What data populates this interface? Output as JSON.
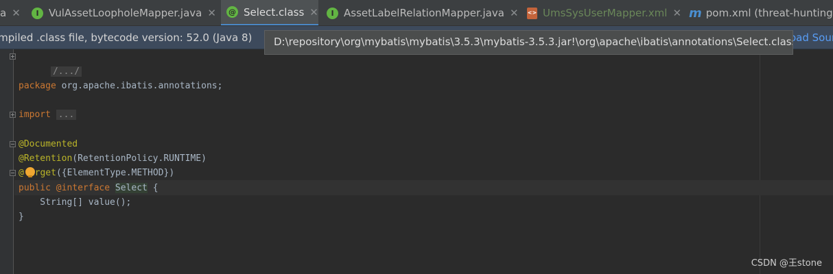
{
  "tabs": [
    {
      "label": "a",
      "icon": "class-file-icon",
      "active": false
    },
    {
      "label": "VulAssetLoopholeMapper.java",
      "icon": "interface-icon",
      "active": false
    },
    {
      "label": "Select.class",
      "icon": "annotation-icon",
      "active": true
    },
    {
      "label": "AssetLabelRelationMapper.java",
      "icon": "interface-icon",
      "active": false
    },
    {
      "label": "UmsSysUserMapper.xml",
      "icon": "xml-file-icon",
      "active": false
    },
    {
      "label": "pom.xml (threat-hunting-",
      "icon": "maven-icon",
      "active": false
    }
  ],
  "banner": {
    "text": "ompiled .class file, bytecode version: 52.0 (Java 8)",
    "link": "oad Sour"
  },
  "tooltip": "D:\\repository\\org\\mybatis\\mybatis\\3.5.3\\mybatis-3.5.3.jar!\\org\\apache\\ibatis\\annotations\\Select.class",
  "code": {
    "header_fold": "/.../",
    "kw_package": "package",
    "package_name": " org.apache.ibatis.annotations;",
    "kw_import": "import",
    "import_fold": "...",
    "ann_documented": "@Documented",
    "ann_retention": "@Retention",
    "retention_args": "(RetentionPolicy.RUNTIME)",
    "ann_target_at": "@",
    "ann_target_rest": "arget",
    "target_args": "({ElementType.METHOD})",
    "kw_public": "public",
    "kw_interface": "@interface",
    "type_name": "Select",
    "open_brace": " {",
    "member": "    String[] value();",
    "close_brace": "}"
  },
  "watermark": "CSDN @王stone",
  "colors": {
    "keyword": "#cc7832",
    "annotation": "#bbb529",
    "text": "#a9b7c6",
    "active_tab_underline": "#4a88c7"
  }
}
